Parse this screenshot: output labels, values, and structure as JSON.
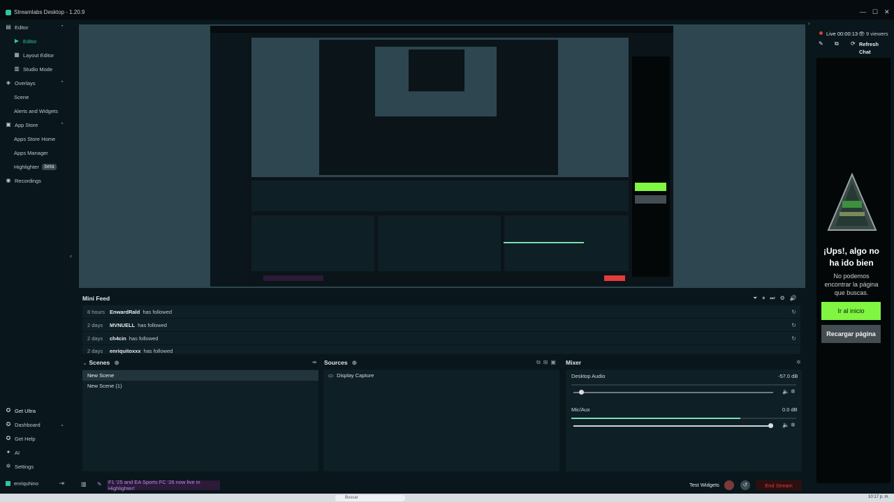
{
  "window": {
    "title": "Streamlabs Desktop - 1.20.9",
    "minimize": "—",
    "maximize": "☐",
    "close": "✕"
  },
  "sidebar": {
    "items": [
      {
        "label": "Editor",
        "icon": "editor-icon",
        "glyph": "▤",
        "chev": "⌃"
      },
      {
        "label": "Editor",
        "icon": "editor-icon",
        "glyph": "▶"
      },
      {
        "label": "Layout Editor",
        "icon": "layout-icon",
        "glyph": "▦"
      },
      {
        "label": "Studio Mode",
        "icon": "studio-icon",
        "glyph": "▥"
      },
      {
        "label": "Overlays",
        "icon": "overlays-icon",
        "glyph": "◈",
        "chev": "⌃"
      },
      {
        "label": "Scene"
      },
      {
        "label": "Alerts and Widgets"
      },
      {
        "label": "App Store",
        "icon": "app-store-icon",
        "glyph": "▣",
        "chev": "⌃"
      },
      {
        "label": "Apps Store Home"
      },
      {
        "label": "Apps Manager"
      },
      {
        "label": "Highlighter",
        "beta": "beta"
      },
      {
        "label": "Recordings",
        "icon": "recordings-icon",
        "glyph": "◉"
      }
    ],
    "bottom": [
      {
        "label": "Get Ultra",
        "glyph": "✪"
      },
      {
        "label": "Dashboard",
        "glyph": "✪",
        "chev": "⌄"
      },
      {
        "label": "Get Help",
        "glyph": "✪"
      },
      {
        "label": "AI",
        "glyph": "✦"
      },
      {
        "label": "Settings",
        "glyph": "✲"
      }
    ],
    "user": {
      "name": "enriquhino",
      "logout": "⇥"
    },
    "collapse_arrow": "‹"
  },
  "mini_feed": {
    "title": "Mini Feed",
    "rows": [
      {
        "time": "8 hours",
        "user": "EnwardRald",
        "action": "has followed"
      },
      {
        "time": "2 days",
        "user": "MVNUELL",
        "action": "has followed"
      },
      {
        "time": "2 days",
        "user": "ch4cin",
        "action": "has followed"
      },
      {
        "time": "2 days",
        "user": "enriquitoxxx",
        "action": "has followed"
      }
    ],
    "redo": "↻",
    "tools": [
      "⏷",
      "⏸",
      "⏭",
      "⚙",
      "🔊"
    ]
  },
  "scenes": {
    "title": "Scenes",
    "items": [
      "New Scene",
      "New Scene (1)"
    ]
  },
  "sources": {
    "title": "Sources",
    "items": [
      "Display Capture"
    ]
  },
  "mixer": {
    "title": "Mixer",
    "channels": [
      {
        "name": "Desktop Audio",
        "db": "-57.0 dB",
        "level": 0.0,
        "volume": 0.03
      },
      {
        "name": "Mic/Aux",
        "db": "0.0 dB",
        "level": 0.75,
        "volume": 1.0
      }
    ]
  },
  "chat": {
    "live": "Live 00:00:13",
    "viewers": "9 viewers",
    "refresh": "Refresh Chat",
    "error_title": "¡Ups!, algo no ha ido bien",
    "error_body": "No podemos encontrar la página que buscas.",
    "home_button": "Ir al inicio",
    "reload_button": "Recargar página"
  },
  "bottom_bar": {
    "promo": "F1 '25 and EA Sports FC '26 now live in Highlighter!",
    "test_widgets": "Test Widgets",
    "end_stream": "End Stream"
  },
  "taskbar": {
    "search": "Buscar",
    "time": "10:17 p. m."
  },
  "colors": {
    "accent": "#31c3a2",
    "chat_green": "#80f542",
    "end_red": "#e33c3c",
    "promo_purple": "#b98ae8"
  }
}
